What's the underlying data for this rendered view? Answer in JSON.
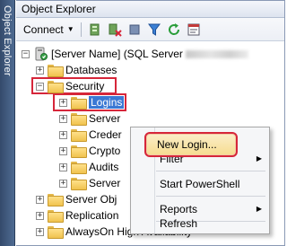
{
  "side_tab": {
    "label": "Object Explorer"
  },
  "window": {
    "title": "Object Explorer"
  },
  "toolbar": {
    "connect_label": "Connect",
    "icons": [
      "connect-server-icon",
      "disconnect-icon",
      "stop-icon",
      "filter-icon",
      "refresh-icon",
      "summary-icon"
    ]
  },
  "tree": {
    "server_label": "[Server Name] (SQL Server",
    "databases": "Databases",
    "security": "Security",
    "logins": "Logins",
    "server_roles": "Server",
    "credentials": "Creder",
    "crypto": "Crypto",
    "audits": "Audits",
    "server_audit": "Server",
    "server_objects": "Server Obj",
    "replication": "Replication",
    "alwayson": "AlwaysOn High Availability"
  },
  "context_menu": {
    "new_login": "New Login...",
    "filter": "Filter",
    "start_powershell": "Start PowerShell",
    "reports": "Reports",
    "refresh": "Refresh"
  },
  "colors": {
    "highlight": "#d6263a",
    "selection": "#3a78d4",
    "panel_tab": "#3d5578"
  }
}
